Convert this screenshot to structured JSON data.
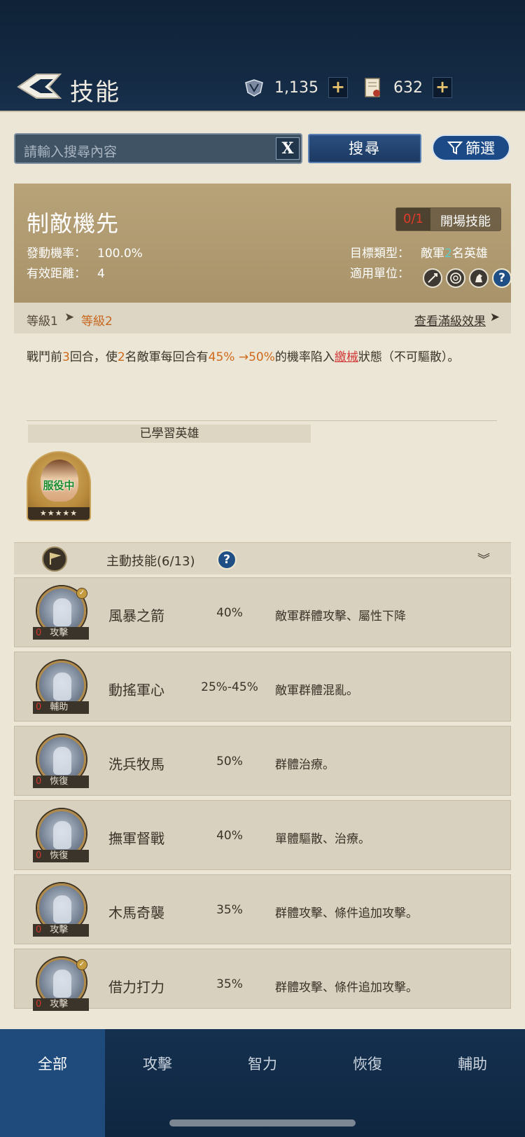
{
  "header": {
    "title": "技能",
    "resources": [
      {
        "icon": "crest-icon",
        "value": "1,135"
      },
      {
        "icon": "scroll-icon",
        "value": "632"
      }
    ],
    "plus": "+"
  },
  "search": {
    "placeholder": "請輸入搜尋內容",
    "clear_label": "X",
    "search_label": "搜尋",
    "filter_label": "篩選"
  },
  "detail": {
    "name": "制敵機先",
    "tag_count": "0/1",
    "tag": "開場技能",
    "stats": {
      "rate_label": "發動機率：",
      "rate_value": "100.0%",
      "range_label": "有效距離：",
      "range_value": "4",
      "target_label": "目標類型：",
      "target_pre": "敵軍",
      "target_num": "2",
      "target_post": "名英雄",
      "units_label": "適用單位："
    },
    "units": [
      "sword-icon",
      "bow-icon",
      "horse-icon",
      "help-icon"
    ],
    "level": {
      "from": "等級1",
      "arrow": "➤",
      "to": "等級2",
      "full_link": "查看滿級效果",
      "full_arrow": "➤"
    },
    "description": {
      "p1": "戰鬥前",
      "p2": "3",
      "p3": "回合，使",
      "p4": "2",
      "p5": "名敵軍每回合有",
      "p6": "45% →50%",
      "p7": "的機率陷入",
      "p8": "繳械",
      "p9": "狀態（不可驅散）。"
    },
    "learned_label": "已學習英雄",
    "hero": {
      "status": "服役中",
      "stars": "★★★★★"
    }
  },
  "list": {
    "title": "主動技能(6/13)",
    "help": "?",
    "chevron": "︾",
    "zero": "0",
    "check": "✓",
    "skills": [
      {
        "name": "風暴之箭",
        "rate": "40%",
        "effect": "敵軍群體攻擊、屬性下降",
        "type": "攻擊",
        "checked": true
      },
      {
        "name": "動搖軍心",
        "rate": "25%-45%",
        "effect": "敵軍群體混亂。",
        "type": "輔助",
        "checked": false
      },
      {
        "name": "洗兵牧馬",
        "rate": "50%",
        "effect": "群體治療。",
        "type": "恢復",
        "checked": false
      },
      {
        "name": "撫軍督戰",
        "rate": "40%",
        "effect": "單體驅散、治療。",
        "type": "恢復",
        "checked": false
      },
      {
        "name": "木馬奇襲",
        "rate": "35%",
        "effect": "群體攻擊、條件追加攻擊。",
        "type": "攻擊",
        "checked": false
      },
      {
        "name": "借力打力",
        "rate": "35%",
        "effect": "群體攻擊、條件追加攻擊。",
        "type": "攻擊",
        "checked": true
      }
    ]
  },
  "nav": {
    "tabs": [
      "全部",
      "攻擊",
      "智力",
      "恢復",
      "輔助"
    ],
    "active": "全部"
  },
  "colors": {
    "highlight": "#cf6a1b",
    "accent_blue": "#1f4b7c"
  }
}
